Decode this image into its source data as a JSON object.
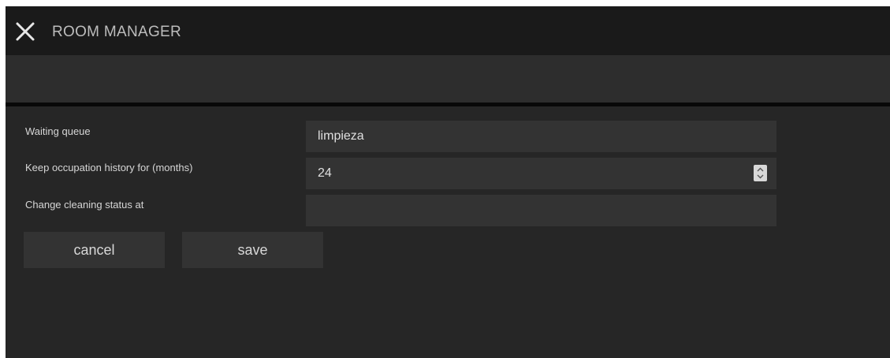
{
  "window": {
    "title": "ROOM MANAGER",
    "close_icon": "close-icon"
  },
  "form": {
    "waiting_queue": {
      "label": "Waiting queue",
      "value": "limpieza"
    },
    "keep_history": {
      "label": "Keep occupation history for (months)",
      "value": "24",
      "spinner_icon": "spinner-updown-icon"
    },
    "cleaning_status": {
      "label": "Change cleaning status at",
      "value": ""
    }
  },
  "actions": {
    "cancel_label": "cancel",
    "save_label": "save"
  }
}
